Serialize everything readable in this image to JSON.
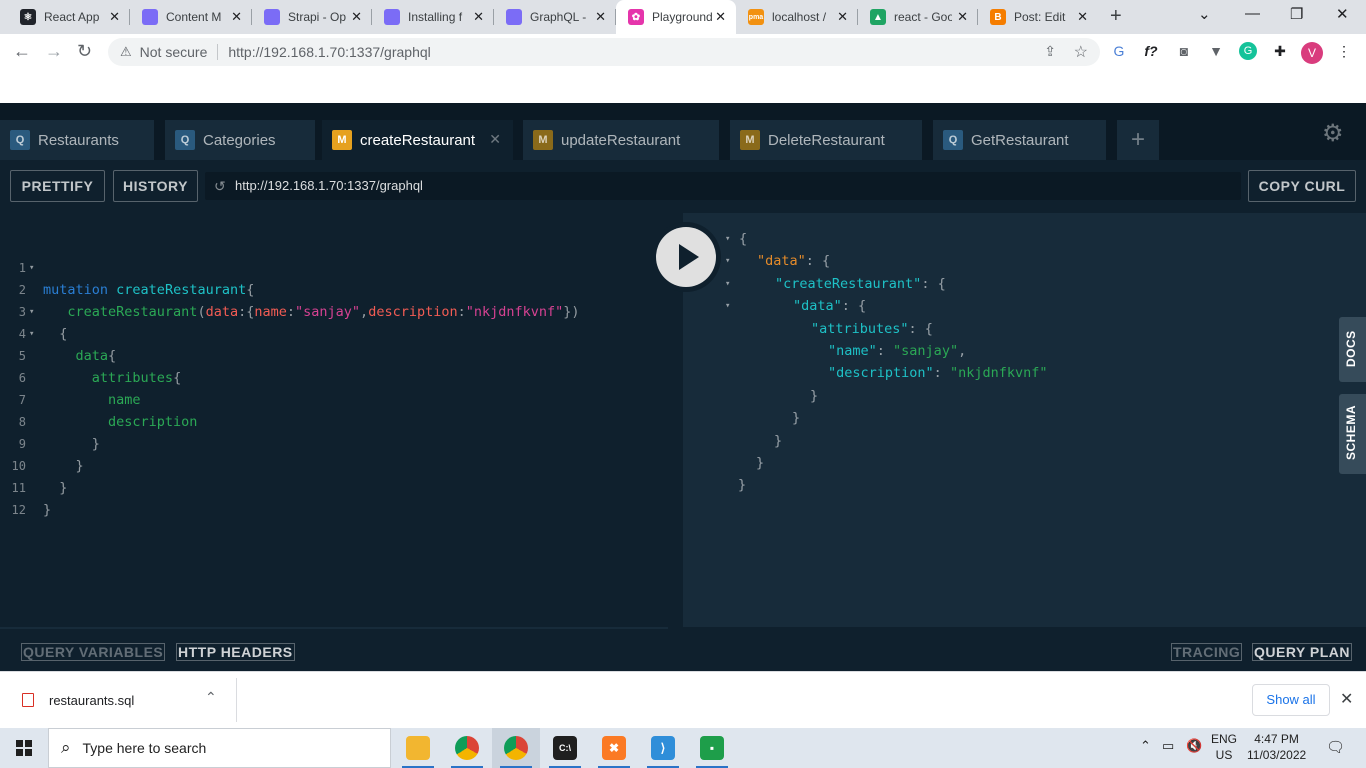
{
  "browser": {
    "tabs": [
      {
        "title": "React App",
        "icon": "react-icon",
        "color": "#20232a"
      },
      {
        "title": "Content M",
        "icon": "strapi-icon",
        "color": "#7b6cf6"
      },
      {
        "title": "Strapi - Op",
        "icon": "strapi-icon",
        "color": "#7b6cf6"
      },
      {
        "title": "Installing f",
        "icon": "strapi-icon",
        "color": "#7b6cf6"
      },
      {
        "title": "GraphQL -",
        "icon": "strapi-icon",
        "color": "#7b6cf6"
      },
      {
        "title": "Playground",
        "icon": "graphql-playground-icon",
        "color": "#e535ab"
      },
      {
        "title": "localhost /",
        "icon": "phpmyadmin-icon",
        "color": "#f29111"
      },
      {
        "title": "react - Goo",
        "icon": "google-drive-icon",
        "color": "#1fa463"
      },
      {
        "title": "Post: Edit",
        "icon": "blogger-icon",
        "color": "#f57d00"
      }
    ],
    "address": {
      "security": "Not secure",
      "url": "http://192.168.1.70:1337/graphql"
    },
    "profile_initial": "V"
  },
  "playground": {
    "tabs": [
      {
        "badge": "Q",
        "label": "Restaurants"
      },
      {
        "badge": "Q",
        "label": "Categories"
      },
      {
        "badge": "M",
        "label": "createRestaurant"
      },
      {
        "badge": "M",
        "label": "updateRestaurant"
      },
      {
        "badge": "M",
        "label": "DeleteRestaurant"
      },
      {
        "badge": "Q",
        "label": "GetRestaurant"
      }
    ],
    "prettify_label": "PRETTIFY",
    "history_label": "HISTORY",
    "endpoint": "http://192.168.1.70:1337/graphql",
    "copy_curl_label": "COPY CURL",
    "docs_label": "DOCS",
    "schema_label": "SCHEMA",
    "query_variables_label": "QUERY VARIABLES",
    "http_headers_label": "HTTP HEADERS",
    "tracing_label": "TRACING",
    "query_plan_label": "QUERY PLAN",
    "editor_line_numbers": [
      "1",
      "2",
      "3",
      "4",
      "5",
      "6",
      "7",
      "8",
      "9",
      "10",
      "11",
      "12"
    ],
    "query": {
      "keyword": "mutation",
      "op_name": "createRestaurant",
      "field": "createRestaurant",
      "arg_data": "data",
      "arg_name": "name",
      "val_name": "\"sanjay\"",
      "arg_desc": "description",
      "val_desc": "\"nkjdnfkvnf\"",
      "f_data": "data",
      "f_attributes": "attributes",
      "f_name": "name",
      "f_description": "description"
    },
    "result": {
      "k_data": "\"data\"",
      "k_create": "\"createRestaurant\"",
      "k_data2": "\"data\"",
      "k_attributes": "\"attributes\"",
      "k_name": "\"name\"",
      "v_name": "\"sanjay\"",
      "k_description": "\"description\"",
      "v_description": "\"nkjdnfkvnf\""
    }
  },
  "downloads": {
    "file": "restaurants.sql",
    "show_all": "Show all"
  },
  "taskbar": {
    "search_placeholder": "Type here to search",
    "lang_top": "ENG",
    "lang_bottom": "US",
    "time": "4:47 PM",
    "date": "11/03/2022"
  }
}
